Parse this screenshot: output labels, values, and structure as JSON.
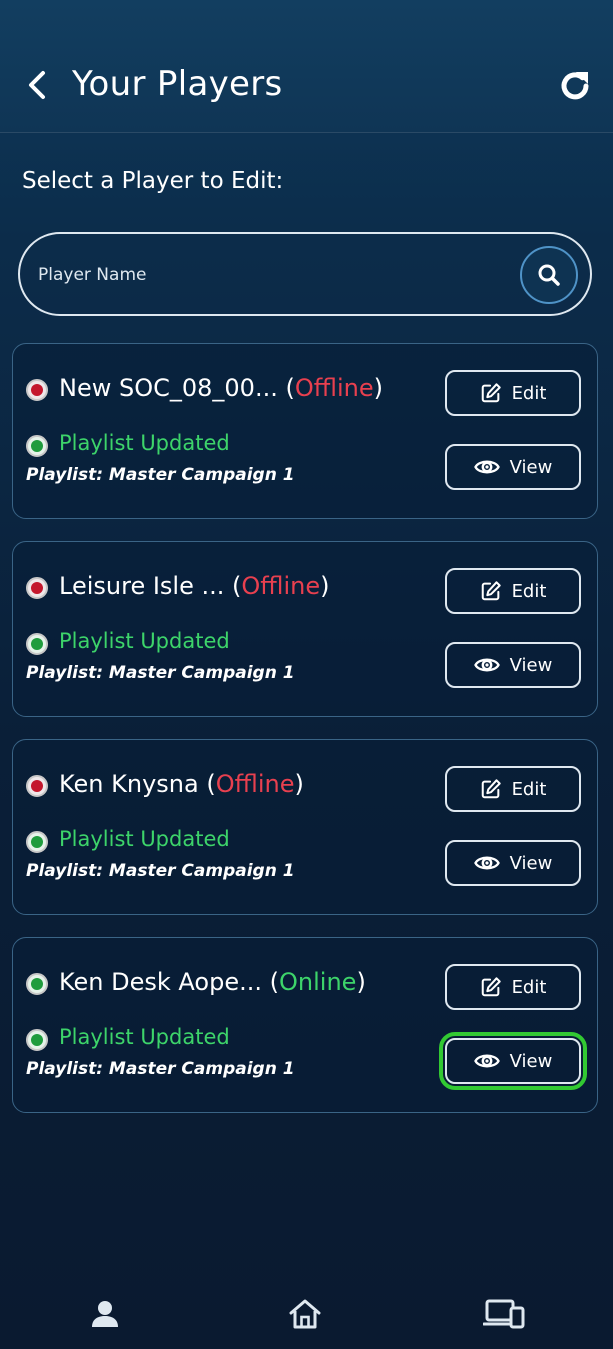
{
  "header": {
    "title": "Your Players"
  },
  "prompt": "Select a Player to Edit:",
  "search": {
    "placeholder": "Player Name"
  },
  "players": [
    {
      "name": "New SOC_08_00...",
      "status": "Offline",
      "status_color": "#e8404f",
      "playlist_status": "Playlist Updated",
      "playlist_prefix": "Playlist",
      "playlist_name": ": Master Campaign 1",
      "edit_label": "Edit",
      "view_label": "View"
    },
    {
      "name": "Leisure Isle ...",
      "status": "Offline",
      "status_color": "#e8404f",
      "playlist_status": "Playlist Updated",
      "playlist_prefix": "Playlist",
      "playlist_name": ": Master Campaign 1",
      "edit_label": "Edit",
      "view_label": "View"
    },
    {
      "name": "Ken Knysna",
      "status": "Offline",
      "status_color": "#e8404f",
      "playlist_status": "Playlist Updated",
      "playlist_prefix": "Playlist",
      "playlist_name": ": Master Campaign 1",
      "edit_label": "Edit",
      "view_label": "View"
    },
    {
      "name": "Ken Desk Aope...",
      "status": "Online",
      "status_color": "#3dd46a",
      "playlist_status": "Playlist Updated",
      "playlist_prefix": "Playlist",
      "playlist_name": ": Master Campaign 1",
      "edit_label": "Edit",
      "view_label": "View"
    }
  ],
  "icons": {
    "back": "chevron-left-icon",
    "refresh": "refresh-icon",
    "search": "search-icon",
    "edit": "edit-icon",
    "view": "eye-icon",
    "profile": "user-icon",
    "home": "home-icon",
    "devices": "devices-icon"
  },
  "colors": {
    "online": "#3dd46a",
    "offline": "#e8404f",
    "highlight": "#32c932"
  }
}
